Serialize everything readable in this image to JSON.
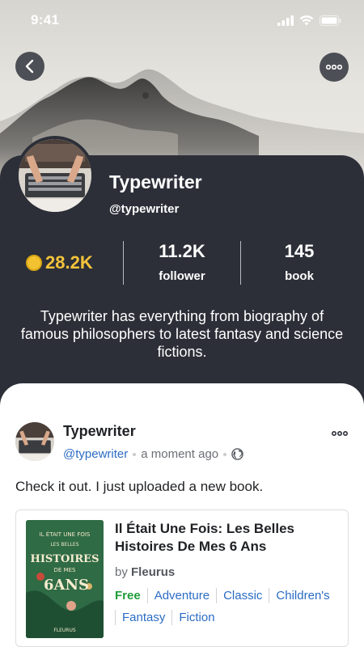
{
  "status_bar": {
    "time": "9:41"
  },
  "profile": {
    "name": "Typewriter",
    "handle": "@typewriter",
    "coins": "28.2K",
    "stats": [
      {
        "value": "11.2K",
        "label": "follower"
      },
      {
        "value": "145",
        "label": "book"
      }
    ],
    "bio": "Typewriter has everything from biography of famous philosophers to latest fantasy and science fictions."
  },
  "post": {
    "author_name": "Typewriter",
    "author_handle": "@typewriter",
    "time": "a moment ago",
    "text": "Check it out. I just uploaded a new book.",
    "book": {
      "title": "Il Était Une Fois: Les Belles Histoires De Mes 6 Ans",
      "author_prefix": "by",
      "author": "Fleurus",
      "tags": [
        "Free",
        "Adventure",
        "Classic",
        "Children's",
        "Fantasy",
        "Fiction"
      ],
      "cover_lines": [
        "IL ÉTAIT UNE FOIS",
        "LES BELLES",
        "HISTOIRES",
        "DE MES",
        "6ANS",
        "FLEURUS"
      ]
    }
  },
  "colors": {
    "panel": "#2c2f38",
    "coin": "#f5c33b",
    "link": "#2b6cc4",
    "free": "#1f9d3a"
  },
  "icons": [
    "back-arrow-icon",
    "more-icon",
    "signal-icon",
    "wifi-icon",
    "battery-icon",
    "coin-icon",
    "globe-icon"
  ]
}
